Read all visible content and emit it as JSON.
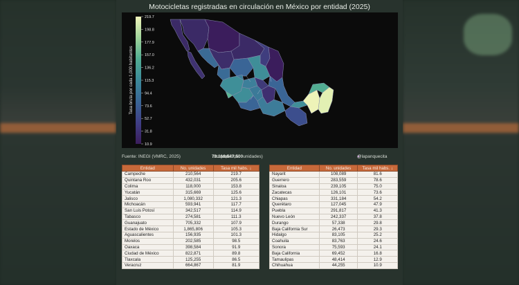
{
  "chart_data": {
    "type": "choropleth",
    "title": "Motocicletas registradas en circulación en México por entidad (2025)",
    "colorbar": {
      "label": "Tasa bruta por cada 1,000 habitantes",
      "ticks": [
        "219.7",
        "198.8",
        "177.9",
        "157.0",
        "136.2",
        "115.3",
        "94.4",
        "73.6",
        "52.7",
        "31.8",
        "10.9"
      ],
      "min": 10.9,
      "max": 219.7,
      "colors": [
        "#3b1d5c",
        "#3f3f86",
        "#3a6596",
        "#3c8a9a",
        "#52ad92",
        "#9ed39a",
        "#f1f4bb"
      ]
    },
    "background": "#0b0b0b"
  },
  "source": "Fuente: INEGI (VMRC, 2025)",
  "national": {
    "prefix": "Tasa nacional: ",
    "rate": "79.1",
    "middle": " (con ",
    "units": "10,547,500",
    "suffix": " unidades)"
  },
  "credit": "@lapanquecita",
  "credit_icon": "●",
  "table": {
    "headers": [
      "Entidad",
      "No. unidades",
      "Tasa mil habs. ↓"
    ],
    "left": [
      [
        "Campeche",
        "210,564",
        "219.7"
      ],
      [
        "Quintana Roo",
        "432,031",
        "205.6"
      ],
      [
        "Colima",
        "118,000",
        "153.8"
      ],
      [
        "Yucatán",
        "315,669",
        "125.6"
      ],
      [
        "Jalisco",
        "1,080,332",
        "121.3"
      ],
      [
        "Michoacán",
        "593,941",
        "117.7"
      ],
      [
        "San Luis Potosí",
        "342,517",
        "114.9"
      ],
      [
        "Tabasco",
        "274,581",
        "111.3"
      ],
      [
        "Guanajuato",
        "705,332",
        "107.9"
      ],
      [
        "Estado de México",
        "1,865,806",
        "105.3"
      ],
      [
        "Aguascalientes",
        "156,935",
        "101.3"
      ],
      [
        "Morelos",
        "202,585",
        "98.5"
      ],
      [
        "Oaxaca",
        "398,584",
        "91.9"
      ],
      [
        "Ciudad de México",
        "822,871",
        "89.8"
      ],
      [
        "Tlaxcala",
        "125,255",
        "86.5"
      ],
      [
        "Veracruz",
        "664,867",
        "81.9"
      ]
    ],
    "right": [
      [
        "Nayarit",
        "108,089",
        "81.6"
      ],
      [
        "Guerrero",
        "283,559",
        "78.6"
      ],
      [
        "Sinaloa",
        "239,105",
        "75.0"
      ],
      [
        "Zacatecas",
        "126,101",
        "73.6"
      ],
      [
        "Chiapas",
        "331,184",
        "54.2"
      ],
      [
        "Querétaro",
        "127,045",
        "47.9"
      ],
      [
        "Puebla",
        "291,817",
        "41.3"
      ],
      [
        "Nuevo León",
        "242,337",
        "37.8"
      ],
      [
        "Durango",
        "57,338",
        "29.8"
      ],
      [
        "Baja California Sur",
        "26,473",
        "29.3"
      ],
      [
        "Hidalgo",
        "83,105",
        "25.2"
      ],
      [
        "Coahuila",
        "83,763",
        "24.6"
      ],
      [
        "Sonora",
        "75,593",
        "24.1"
      ],
      [
        "Baja California",
        "69,452",
        "16.8"
      ],
      [
        "Tamaulipas",
        "48,414",
        "12.9"
      ],
      [
        "Chihuahua",
        "44,255",
        "10.9"
      ]
    ]
  }
}
